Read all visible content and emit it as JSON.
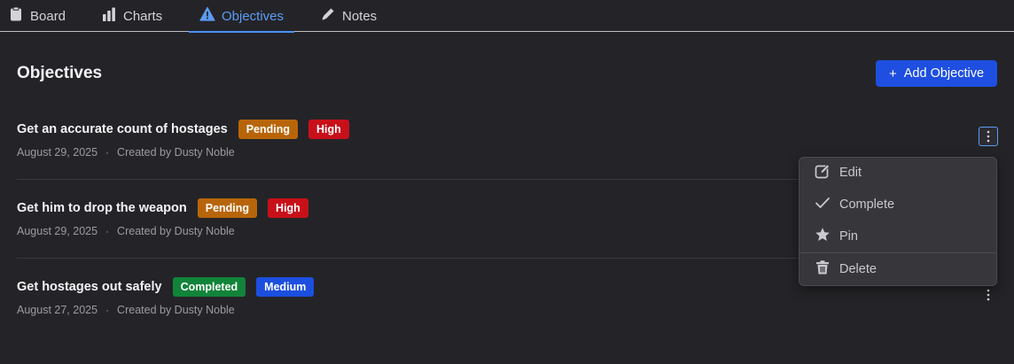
{
  "tabs": [
    {
      "label": "Board",
      "icon": "clipboard-icon"
    },
    {
      "label": "Charts",
      "icon": "bar-chart-icon"
    },
    {
      "label": "Objectives",
      "icon": "warning-triangle-icon",
      "active": true
    },
    {
      "label": "Notes",
      "icon": "pencil-icon"
    }
  ],
  "page": {
    "title": "Objectives",
    "add_button": {
      "icon": "plus-icon",
      "label": "Add Objective"
    }
  },
  "objectives": [
    {
      "title": "Get an accurate count of hostages",
      "status": {
        "label": "Pending",
        "color": "#b8650a"
      },
      "priority": {
        "label": "High",
        "color": "#c8101a"
      },
      "date": "August 29, 2025",
      "separator": "·",
      "created_by": "Created by Dusty Noble"
    },
    {
      "title": "Get him to drop the weapon",
      "status": {
        "label": "Pending",
        "color": "#b8650a"
      },
      "priority": {
        "label": "High",
        "color": "#c8101a"
      },
      "date": "August 29, 2025",
      "separator": "·",
      "created_by": "Created by Dusty Noble"
    },
    {
      "title": "Get hostages out safely",
      "status": {
        "label": "Completed",
        "color": "#12843a"
      },
      "priority": {
        "label": "Medium",
        "color": "#1c4fe0"
      },
      "date": "August 27, 2025",
      "separator": "·",
      "created_by": "Created by Dusty Noble"
    }
  ],
  "context_menu": {
    "items": [
      {
        "label": "Edit",
        "icon": "edit-icon"
      },
      {
        "label": "Complete",
        "icon": "checkmark-icon"
      },
      {
        "label": "Pin",
        "icon": "star-icon"
      },
      {
        "label": "Delete",
        "icon": "trash-icon"
      }
    ]
  },
  "colors": {
    "accent": "#5b9bf5",
    "primary_button": "#1e4fe0",
    "background": "#242428"
  }
}
